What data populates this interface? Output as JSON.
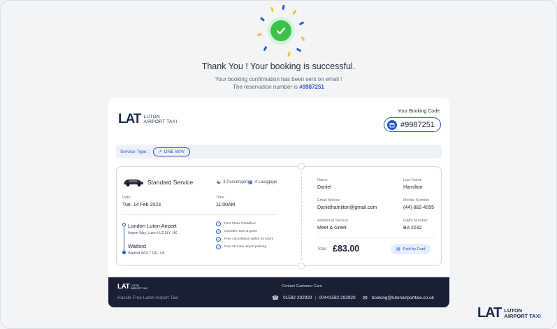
{
  "success": {
    "title": "Thank You ! Your booking is successful.",
    "line1": "Your booking confirmation has been sent on email !",
    "line2_prefix": "The reservation number is ",
    "reservation_number": "#9987251"
  },
  "brand": {
    "mark": "LAT",
    "name_line1": "LUTON",
    "name_line2": "AIRPORT TA",
    "name_line2_accent": "XI",
    "accent_color": "#2456c8",
    "dark_color": "#1d2b4a"
  },
  "booking_code": {
    "label": "Your Booking Code",
    "value": "#9987251"
  },
  "service_type": {
    "label": "Service Type :",
    "value": "ONE WAY"
  },
  "trip": {
    "service": "Standard Service",
    "passengers": "3 Passengers",
    "luggage": "4 Lauggage",
    "date_label": "Date",
    "date": "Tue, 14 Feb 2023",
    "time_label": "Time",
    "time": "11:00AM",
    "from_place": "London Luton Airport",
    "from_addr": "Airport Way, Luton LU2 9LY, UK",
    "to_place": "Watford",
    "to_addr": "Watford WD17 1RL, UK",
    "features": [
      "First Class Chauffeur",
      "Includes meet & greet",
      "Free cancellation within 24 hours",
      "Free 60 mins airport parking"
    ]
  },
  "customer": {
    "name_label": "Name",
    "name": "Daniel",
    "last_name_label": "Last Name",
    "last_name": "Hamilton",
    "email_label": "Email Adress",
    "email": "Danielhamilton@gmail.com",
    "mobile_label": "Mobile Number",
    "mobile": "(44) 882-4055",
    "additional_label": "Additional Service",
    "additional": "Meet & Greet",
    "flight_label": "Flight Number",
    "flight": "BA 2032",
    "total_label": "Total",
    "total": "£83.00",
    "paid": "Paid by Card"
  },
  "footer": {
    "tagline": "Hassle Free Luton Airport Taxi",
    "care_label": "Contact Customer Care",
    "phone1": "01582 292929",
    "separator": "|",
    "phone2": "00441582 292929",
    "email": "booking@lutonairporttaxi.co.uk"
  }
}
